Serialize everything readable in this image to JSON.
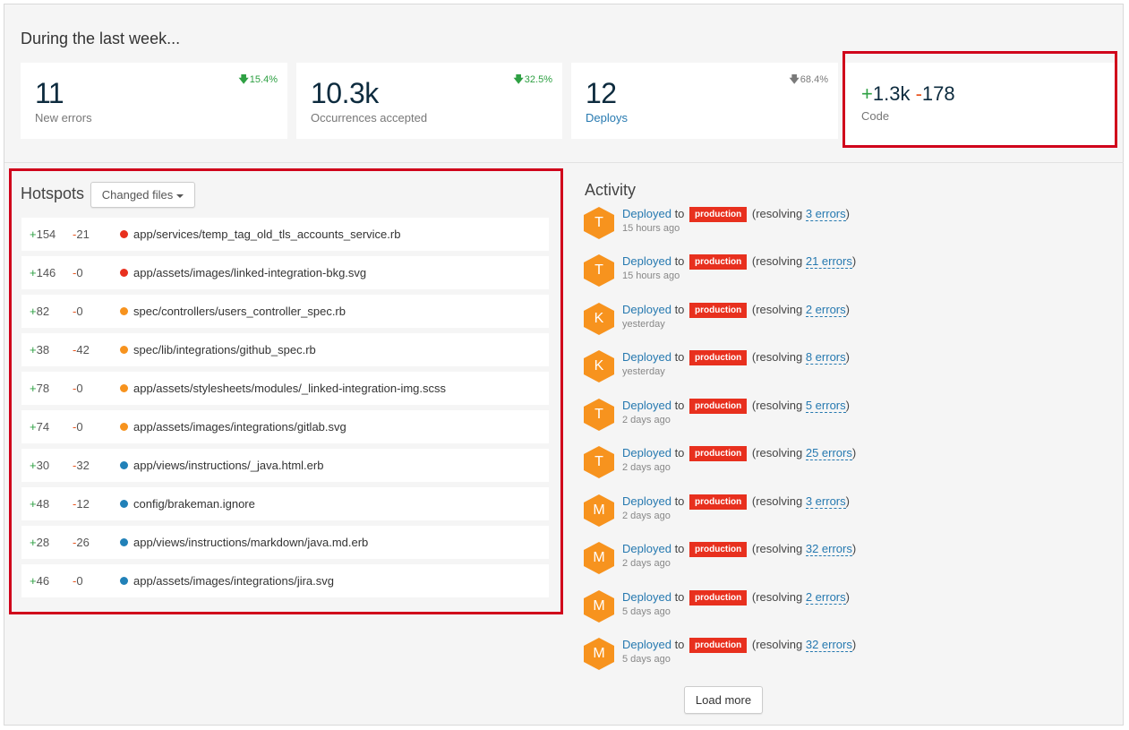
{
  "summary": {
    "title": "During the last week...",
    "cards": [
      {
        "value": "11",
        "label": "New errors",
        "trend": "15.4%",
        "trend_dir": "up"
      },
      {
        "value": "10.3k",
        "label": "Occurrences accepted",
        "trend": "32.5%",
        "trend_dir": "up"
      },
      {
        "value": "12",
        "label": "Deploys",
        "trend": "68.4%",
        "trend_dir": "down"
      }
    ],
    "code": {
      "plus_sign": "+",
      "plus": "1.3k",
      "minus_sign": "-",
      "minus": "178",
      "label": "Code"
    }
  },
  "hotspots": {
    "title": "Hotspots",
    "dropdown_label": "Changed files",
    "rows": [
      {
        "add": "+154",
        "del": "-21",
        "color": "#e8301e",
        "path": "app/services/temp_tag_old_tls_accounts_service.rb"
      },
      {
        "add": "+146",
        "del": "-0",
        "color": "#e8301e",
        "path": "app/assets/images/linked-integration-bkg.svg"
      },
      {
        "add": "+82",
        "del": "-0",
        "color": "#f7931e",
        "path": "spec/controllers/users_controller_spec.rb"
      },
      {
        "add": "+38",
        "del": "-42",
        "color": "#f7931e",
        "path": "spec/lib/integrations/github_spec.rb"
      },
      {
        "add": "+78",
        "del": "-0",
        "color": "#f7931e",
        "path": "app/assets/stylesheets/modules/_linked-integration-img.scss"
      },
      {
        "add": "+74",
        "del": "-0",
        "color": "#f7931e",
        "path": "app/assets/images/integrations/gitlab.svg"
      },
      {
        "add": "+30",
        "del": "-32",
        "color": "#2181b8",
        "path": "app/views/instructions/_java.html.erb"
      },
      {
        "add": "+48",
        "del": "-12",
        "color": "#2181b8",
        "path": "config/brakeman.ignore"
      },
      {
        "add": "+28",
        "del": "-26",
        "color": "#2181b8",
        "path": "app/views/instructions/markdown/java.md.erb"
      },
      {
        "add": "+46",
        "del": "-0",
        "color": "#2181b8",
        "path": "app/assets/images/integrations/jira.svg"
      }
    ]
  },
  "activity": {
    "title": "Activity",
    "deployed_text": "Deployed",
    "to_text": "to",
    "env": "production",
    "resolving_prefix": "(resolving ",
    "resolving_suffix": ")",
    "items": [
      {
        "initial": "T",
        "errors": "3 errors",
        "time": "15 hours ago"
      },
      {
        "initial": "T",
        "errors": "21 errors",
        "time": "15 hours ago"
      },
      {
        "initial": "K",
        "errors": "2 errors",
        "time": "yesterday"
      },
      {
        "initial": "K",
        "errors": "8 errors",
        "time": "yesterday"
      },
      {
        "initial": "T",
        "errors": "5 errors",
        "time": "2 days ago"
      },
      {
        "initial": "T",
        "errors": "25 errors",
        "time": "2 days ago"
      },
      {
        "initial": "M",
        "errors": "3 errors",
        "time": "2 days ago"
      },
      {
        "initial": "M",
        "errors": "32 errors",
        "time": "2 days ago"
      },
      {
        "initial": "M",
        "errors": "2 errors",
        "time": "5 days ago"
      },
      {
        "initial": "M",
        "errors": "32 errors",
        "time": "5 days ago"
      }
    ],
    "load_more": "Load more"
  },
  "colors": {
    "highlight_border": "#d0021b",
    "avatar": "#f7931e",
    "env_badge": "#e8301e",
    "positive": "#2ea043",
    "negative": "#e8541e",
    "link": "#2679b0"
  }
}
